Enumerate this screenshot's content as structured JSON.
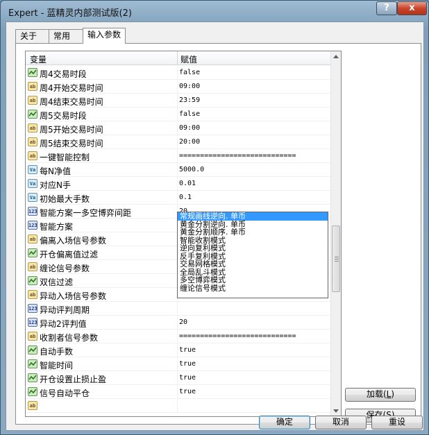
{
  "window": {
    "title": "Expert - 蓝精灵内部测试版(2)",
    "help_label": "?",
    "close_label": "x"
  },
  "tabs": [
    {
      "label": "关于"
    },
    {
      "label": "常用"
    },
    {
      "label": "输入参数"
    }
  ],
  "grid": {
    "col_variable": "变量",
    "col_value": "赋值",
    "rows": [
      {
        "type": "bool",
        "icon": "",
        "name": "周4交易时段",
        "value": "false"
      },
      {
        "type": "str",
        "icon": "ab",
        "name": "周4开始交易时间",
        "value": "09:00"
      },
      {
        "type": "str",
        "icon": "ab",
        "name": "周4结束交易时间",
        "value": "23:59"
      },
      {
        "type": "bool",
        "icon": "",
        "name": "周5交易时段",
        "value": "false"
      },
      {
        "type": "str",
        "icon": "ab",
        "name": "周5开始交易时间",
        "value": "09:00"
      },
      {
        "type": "str",
        "icon": "ab",
        "name": "周5结束交易时间",
        "value": "20:00"
      },
      {
        "type": "str",
        "icon": "ab",
        "name": "一键智能控制",
        "value": "============================"
      },
      {
        "type": "dbl",
        "icon": "Va",
        "name": "每N净值",
        "value": "5000.0"
      },
      {
        "type": "dbl",
        "icon": "Va",
        "name": "对应N手",
        "value": "0.01"
      },
      {
        "type": "dbl",
        "icon": "Va",
        "name": "初始最大手数",
        "value": "0.1"
      },
      {
        "type": "int",
        "icon": "123",
        "name": "智能方案一多空博弈间距",
        "value": "20"
      },
      {
        "type": "int",
        "icon": "123",
        "name": "智能方案",
        "value": "常规画线逆向. 单币"
      },
      {
        "type": "str",
        "icon": "ab",
        "name": "偏离入场信号参数",
        "value": ""
      },
      {
        "type": "bool",
        "icon": "",
        "name": "开仓偏离值过滤",
        "value": ""
      },
      {
        "type": "str",
        "icon": "ab",
        "name": "缠论信号参数",
        "value": ""
      },
      {
        "type": "bool",
        "icon": "",
        "name": "双信过滤",
        "value": ""
      },
      {
        "type": "str",
        "icon": "ab",
        "name": "异动入场信号参数",
        "value": ""
      },
      {
        "type": "int",
        "icon": "123",
        "name": "异动评判周期",
        "value": ""
      },
      {
        "type": "int",
        "icon": "123",
        "name": "异动2评判值",
        "value": "20"
      },
      {
        "type": "str",
        "icon": "ab",
        "name": "收割者信号参数",
        "value": "============================"
      },
      {
        "type": "bool",
        "icon": "",
        "name": "自动手数",
        "value": "true"
      },
      {
        "type": "bool",
        "icon": "",
        "name": "智能时间",
        "value": "true"
      },
      {
        "type": "bool",
        "icon": "",
        "name": "开仓设置止损止盈",
        "value": "true"
      },
      {
        "type": "bool",
        "icon": "",
        "name": "信号自动平仓",
        "value": "true"
      },
      {
        "type": "str",
        "icon": "ab",
        "name": "",
        "value": ""
      }
    ],
    "dropdown": {
      "selected": "常规画线逆向. 单币",
      "options": [
        "常规画线逆向. 单币",
        "黄金分割逆向. 单币",
        "黄金分割顺序. 单币",
        "智能收割模式",
        "逆向复利模式",
        "反手复利模式",
        "交易网格模式",
        "全局乱斗模式",
        "多空博弈模式",
        "缠论信号模式"
      ]
    }
  },
  "side_buttons": {
    "load": {
      "label": "加载",
      "hotkey": "L",
      "text_before": "加载(",
      "text_after": ")"
    },
    "save": {
      "label": "保存",
      "hotkey": "S",
      "text_before": "保存(",
      "text_after": ")"
    }
  },
  "bottom_buttons": {
    "ok": "确定",
    "cancel": "取消",
    "reset": "重设"
  }
}
